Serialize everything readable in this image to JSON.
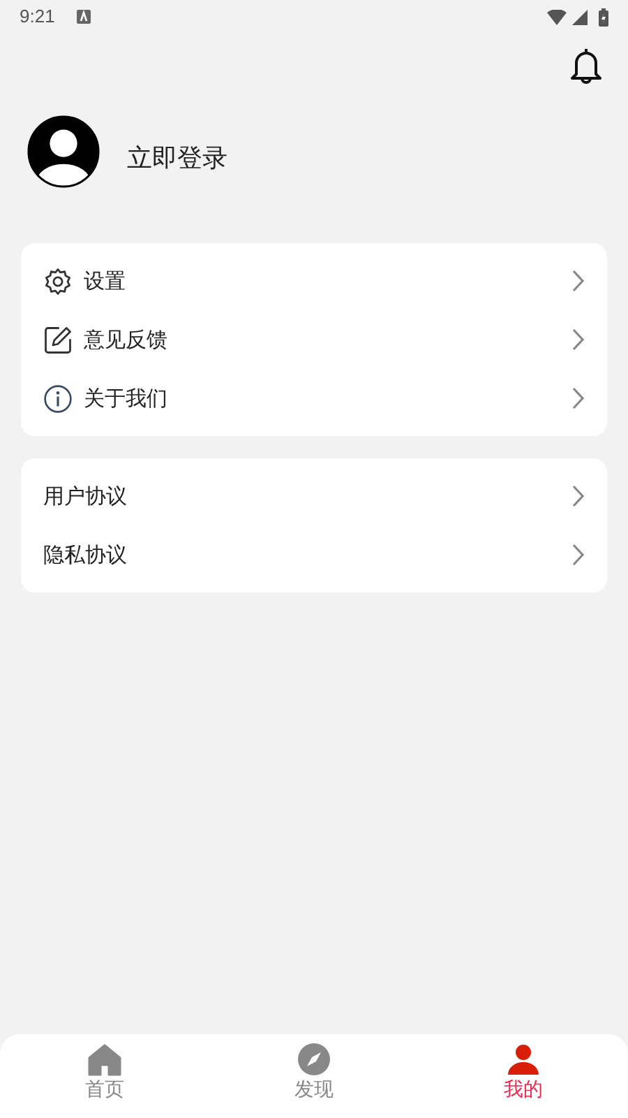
{
  "status_bar": {
    "time": "9:21"
  },
  "profile": {
    "login_label": "立即登录"
  },
  "menu_groups": [
    {
      "items": [
        {
          "label": "设置",
          "kind": "gear"
        },
        {
          "label": "意见反馈",
          "kind": "edit"
        },
        {
          "label": "关于我们",
          "kind": "info"
        }
      ]
    },
    {
      "items": [
        {
          "label": "用户协议",
          "kind": "plain"
        },
        {
          "label": "隐私协议",
          "kind": "plain"
        }
      ]
    }
  ],
  "bottom_nav": [
    {
      "label": "首页",
      "kind": "home",
      "selected": false
    },
    {
      "label": "发现",
      "kind": "compass",
      "selected": false
    },
    {
      "label": "我的",
      "kind": "person",
      "selected": true
    }
  ]
}
